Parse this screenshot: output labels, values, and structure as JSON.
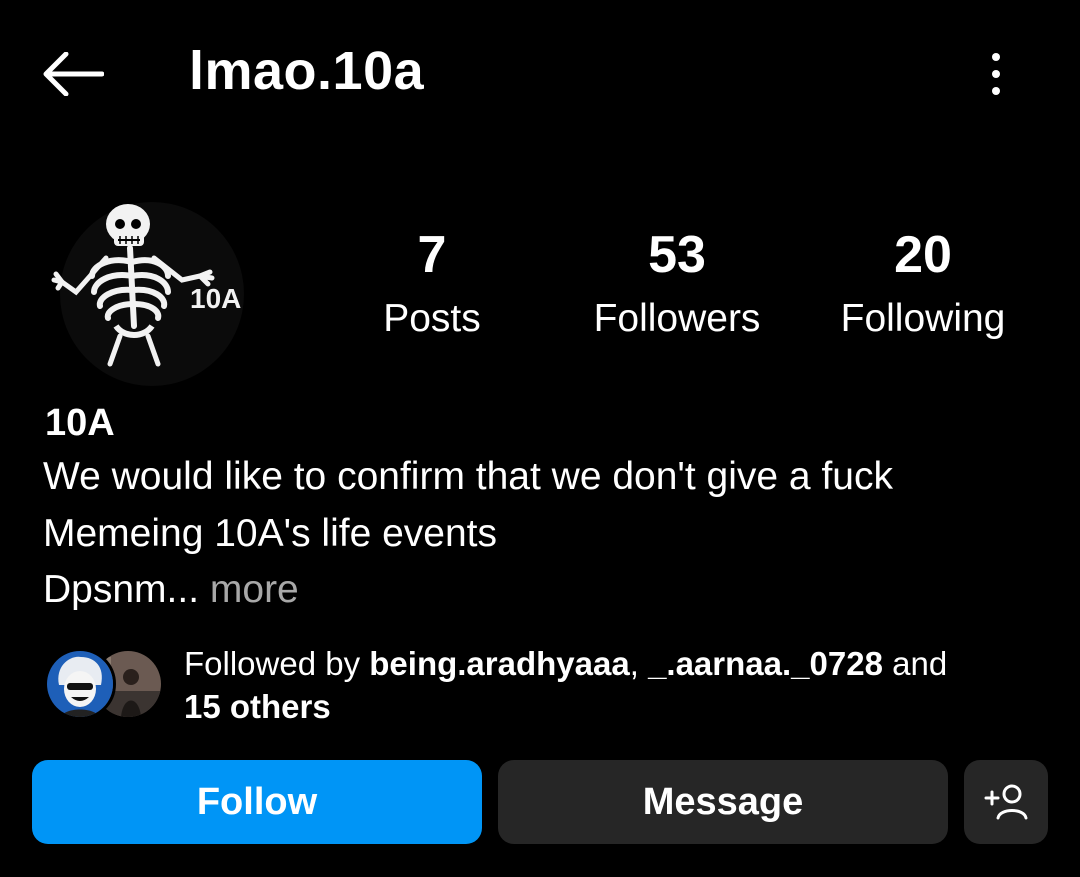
{
  "header": {
    "username": "lmao.10a"
  },
  "profile": {
    "avatar_text": "10A",
    "display_name": "10A",
    "bio_lines": [
      "We would like to confirm that we don't give a fuck",
      "Memeing 10A's life events",
      "Dpsnm..."
    ],
    "more_label": "more"
  },
  "stats": [
    {
      "count": "7",
      "label": "Posts"
    },
    {
      "count": "53",
      "label": "Followers"
    },
    {
      "count": "20",
      "label": "Following"
    }
  ],
  "followed_by": {
    "prefix": "Followed by",
    "users": [
      "being.aradhyaaa",
      "_.aarnaa._0728"
    ],
    "separator": ",",
    "and": "and",
    "others": "15 others"
  },
  "actions": {
    "follow_label": "Follow",
    "message_label": "Message"
  },
  "icons": {
    "back": "arrow-left-icon",
    "more": "more-vertical-icon",
    "suggest": "add-person-icon"
  },
  "colors": {
    "background": "#000000",
    "follow_button": "#0095f6",
    "secondary_button": "#262626",
    "muted_text": "#a8a8a8"
  }
}
